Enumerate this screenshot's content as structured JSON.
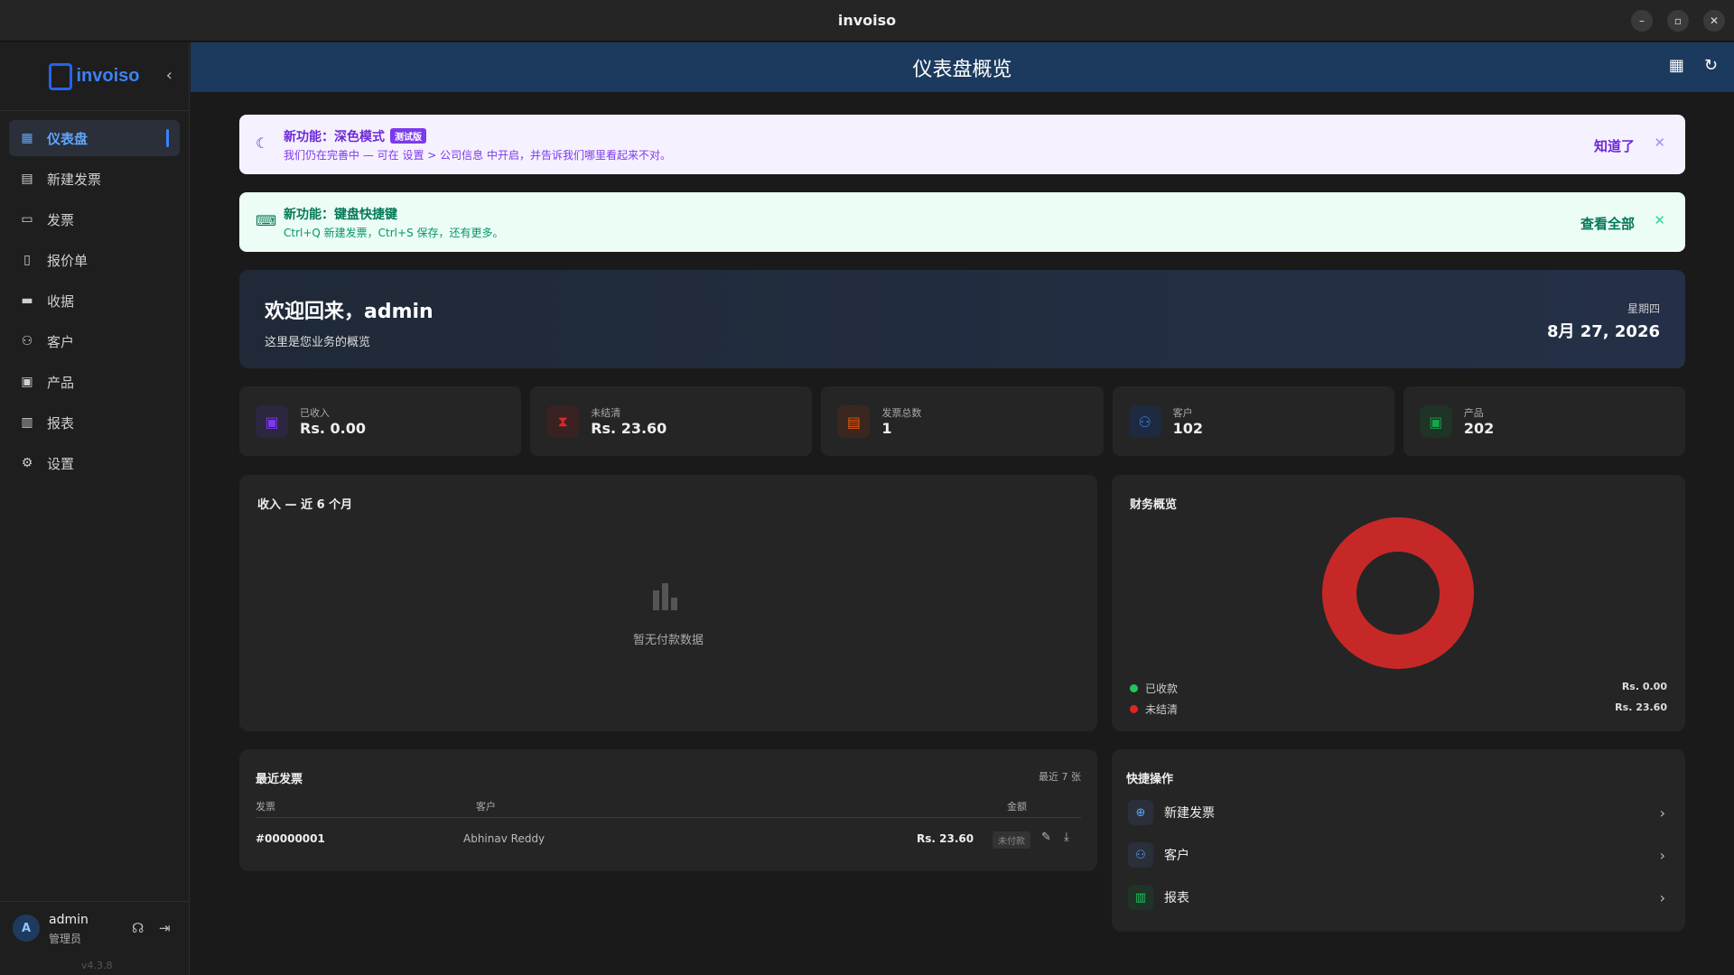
{
  "window": {
    "title": "invoiso"
  },
  "sidebar": {
    "logo_text": "invoiso",
    "items": [
      {
        "label": "仪表盘"
      },
      {
        "label": "新建发票"
      },
      {
        "label": "发票"
      },
      {
        "label": "报价单"
      },
      {
        "label": "收据"
      },
      {
        "label": "客户"
      },
      {
        "label": "产品"
      },
      {
        "label": "报表"
      },
      {
        "label": "设置"
      }
    ],
    "user": {
      "initial": "A",
      "name": "admin",
      "role": "管理员",
      "version": "v4.3.8"
    }
  },
  "header": {
    "title": "仪表盘概览"
  },
  "banners": {
    "dark_mode": {
      "title": "新功能：深色模式",
      "badge": "测试版",
      "desc": "我们仍在完善中 — 可在 设置 > 公司信息 中开启，并告诉我们哪里看起来不对。",
      "action": "知道了"
    },
    "shortcuts": {
      "title": "新功能：键盘快捷键",
      "desc": "Ctrl+Q 新建发票，Ctrl+S 保存，还有更多。",
      "action": "查看全部"
    }
  },
  "welcome": {
    "title": "欢迎回来，admin",
    "subtitle": "这里是您业务的概览",
    "weekday": "星期四",
    "date": "8月 27, 2026"
  },
  "stats": [
    {
      "label": "已收入",
      "value": "Rs. 0.00",
      "color": "#7c3aed"
    },
    {
      "label": "未结清",
      "value": "Rs. 23.60",
      "color": "#dc2626"
    },
    {
      "label": "发票总数",
      "value": "1",
      "color": "#ea580c"
    },
    {
      "label": "客户",
      "value": "102",
      "color": "#3b82f6"
    },
    {
      "label": "产品",
      "value": "202",
      "color": "#16a34a"
    }
  ],
  "revenue_card": {
    "title": "收入 — 近 6 个月",
    "empty_text": "暂无付款数据"
  },
  "finance_card": {
    "title": "财务概览",
    "legend": [
      {
        "label": "已收款",
        "value": "Rs. 0.00",
        "color": "#22c55e"
      },
      {
        "label": "未结清",
        "value": "Rs. 23.60",
        "color": "#dc2626"
      }
    ]
  },
  "chart_data": {
    "type": "pie",
    "title": "财务概览",
    "categories": [
      "已收款",
      "未结清"
    ],
    "values": [
      0.0,
      23.6
    ],
    "colors": [
      "#22c55e",
      "#c62828"
    ]
  },
  "recent_invoices": {
    "title": "最近发票",
    "meta": "最近 7 张",
    "columns": [
      "发票",
      "客户",
      "金额"
    ],
    "rows": [
      {
        "number": "#00000001",
        "customer": "Abhinav Reddy",
        "amount": "Rs. 23.60",
        "status": "未付款"
      }
    ]
  },
  "quick_actions": {
    "title": "快捷操作",
    "items": [
      {
        "label": "新建发票"
      },
      {
        "label": "客户"
      },
      {
        "label": "报表"
      }
    ]
  }
}
